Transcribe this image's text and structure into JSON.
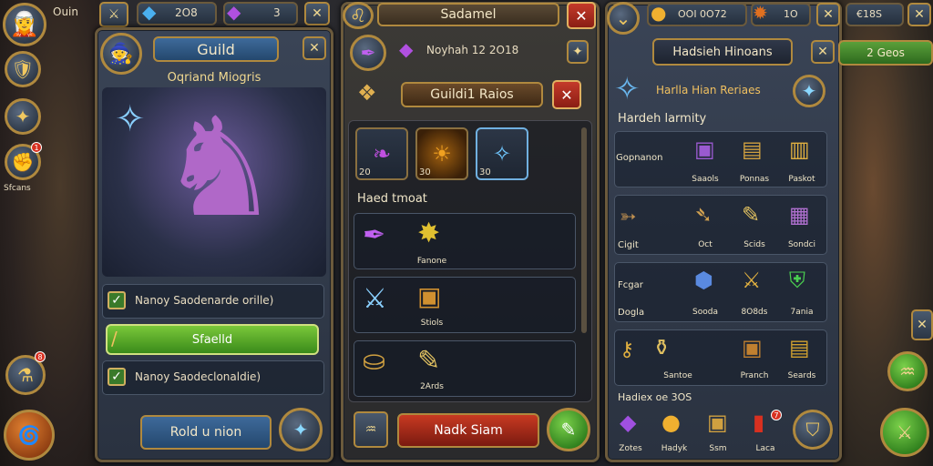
{
  "top_left": {
    "name": "Ouin"
  },
  "resources": {
    "gems": "2O8",
    "crystals": "3",
    "gold": "OOI 0O72",
    "keys": "1O",
    "hp": "€18S"
  },
  "guild_panel": {
    "title": "Guild",
    "hero_name": "Oqriand Miogris",
    "options": [
      {
        "label": "Nanoy Saodenarde orille)",
        "checked": true
      },
      {
        "label": "Sfaelld",
        "highlight": true
      },
      {
        "label": "Nanoy Saodeclonaldie)",
        "checked": true
      }
    ],
    "bottom_button": "Rold u nion"
  },
  "left_rail": {
    "label": "Sfcans",
    "badge": "1",
    "badge2": "8"
  },
  "middle_panel": {
    "title": "Sadamel",
    "item_title": "Noyhah 12 2O18",
    "subtitle": "Guildi1 Raios",
    "slots": [
      {
        "icon": "purple-wing-icon",
        "count": "20"
      },
      {
        "icon": "gold-orb-icon",
        "count": "30"
      },
      {
        "icon": "blue-crystal-icon",
        "count": "30"
      }
    ],
    "section_header": "Haed tmoat",
    "rows": [
      {
        "items": [
          {
            "icon": "purple-feather-icon",
            "label": ""
          },
          {
            "icon": "gold-star-icon",
            "label": "Fanone"
          }
        ]
      },
      {
        "items": [
          {
            "icon": "crossed-sword-icon",
            "label": ""
          },
          {
            "icon": "treasure-chest-icon",
            "label": "Stiols"
          }
        ]
      },
      {
        "items": [
          {
            "icon": "gold-chest-icon",
            "label": ""
          },
          {
            "icon": "gold-scroll-icon",
            "label": "2Ards"
          }
        ]
      }
    ],
    "bottom_button": "Nadk Siam"
  },
  "right_panel": {
    "title": "Hadsieh Hinoans",
    "sub_title": "Harlla Hian Reriaes",
    "section_header": "Hardeh larmity",
    "rows": [
      {
        "label": "Gopnanon",
        "items": [
          "Saaols",
          "Ponnas",
          "Paskot"
        ]
      },
      {
        "label": "Cigit",
        "items": [
          "Oct",
          "Scids",
          "Sondci"
        ]
      },
      {
        "label": "Fcgar",
        "sublabel": "Dogla",
        "items": [
          "Sooda",
          "8O8ds",
          "7ania"
        ]
      },
      {
        "label": "",
        "items": [
          "Santoe",
          "Pranch",
          "Seards"
        ]
      }
    ],
    "footer_header": "Hadiex oe 3OS",
    "footer_items": [
      "Zotes",
      "Hadyk",
      "Ssm",
      "Laca"
    ],
    "badge": "7"
  },
  "right_edge": {
    "label": "2 Geos"
  }
}
